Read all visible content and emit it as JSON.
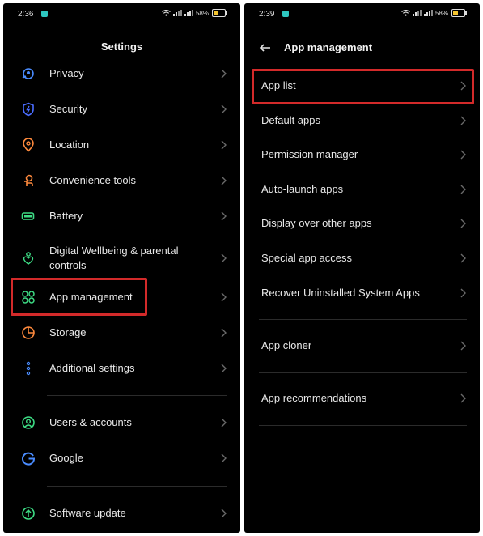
{
  "left_screen": {
    "status": {
      "time": "2:36",
      "battery": "58%"
    },
    "title": "Settings",
    "items": [
      {
        "label": "Privacy",
        "icon": "privacy-icon",
        "color": "#4a8cff"
      },
      {
        "label": "Security",
        "icon": "shield-icon",
        "color": "#4a6cff"
      },
      {
        "label": "Location",
        "icon": "location-icon",
        "color": "#ff8a3d"
      },
      {
        "label": "Convenience tools",
        "icon": "hand-icon",
        "color": "#ff8a3d"
      },
      {
        "label": "Battery",
        "icon": "battery-icon",
        "color": "#3ddc84"
      },
      {
        "label": "Digital Wellbeing & parental controls",
        "icon": "wellbeing-icon",
        "color": "#3ddc84"
      },
      {
        "label": "App management",
        "icon": "apps-grid-icon",
        "color": "#3ddc84"
      },
      {
        "label": "Storage",
        "icon": "storage-pie-icon",
        "color": "#ff8a3d"
      },
      {
        "label": "Additional settings",
        "icon": "dots-vertical-icon",
        "color": "#4a8cff"
      },
      {
        "label": "Users & accounts",
        "icon": "user-icon",
        "color": "#3ddc84"
      },
      {
        "label": "Google",
        "icon": "google-icon",
        "color": "#4a8cff"
      },
      {
        "label": "Software update",
        "icon": "update-arrow-icon",
        "color": "#3ddc84"
      }
    ]
  },
  "right_screen": {
    "status": {
      "time": "2:39",
      "battery": "58%"
    },
    "title": "App management",
    "items": [
      {
        "label": "App list"
      },
      {
        "label": "Default apps"
      },
      {
        "label": "Permission manager"
      },
      {
        "label": "Auto-launch apps"
      },
      {
        "label": "Display over other apps"
      },
      {
        "label": "Special app access"
      },
      {
        "label": "Recover Uninstalled System Apps"
      },
      {
        "label": "App cloner"
      },
      {
        "label": "App recommendations"
      }
    ]
  },
  "colors": {
    "highlight": "#d32a2a",
    "background": "#000000",
    "text": "#e8e8e8",
    "chevron": "#6a6a6a"
  }
}
